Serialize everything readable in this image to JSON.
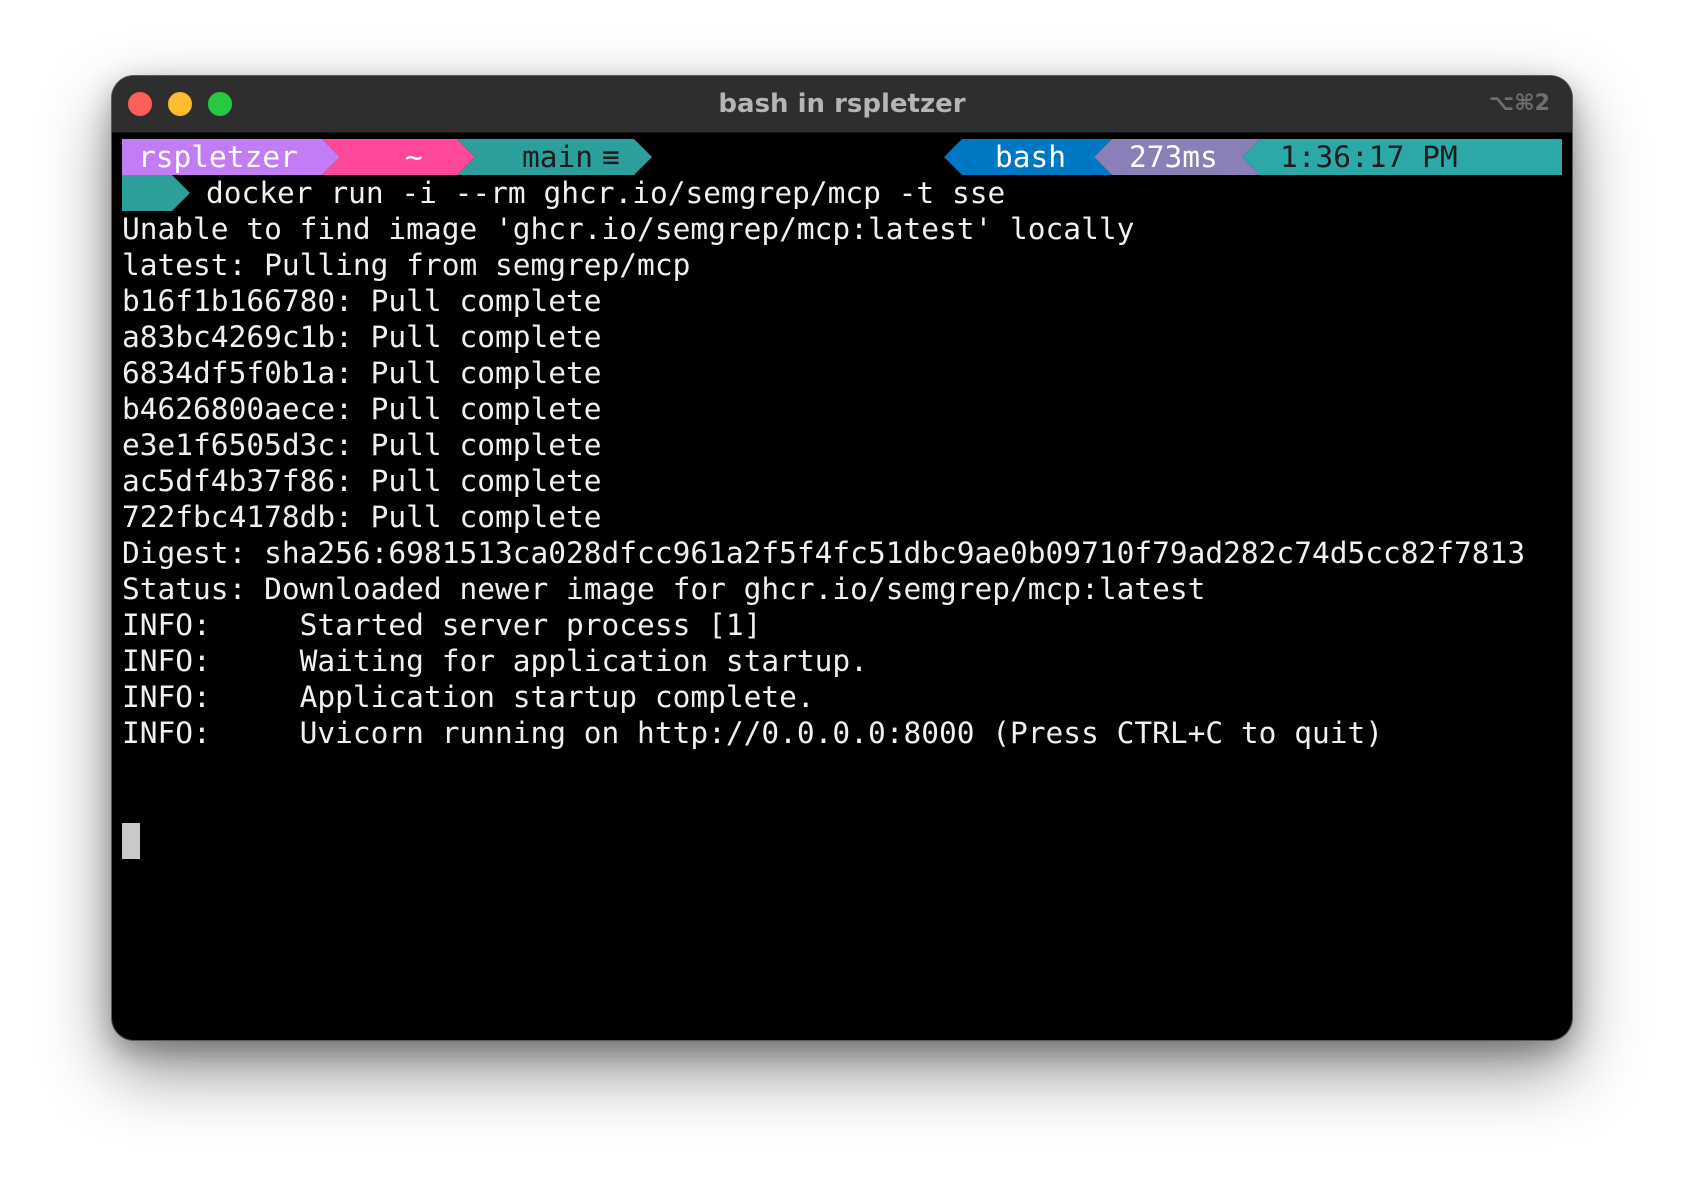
{
  "window": {
    "title": "bash in rspletzer",
    "shortcut": "⌥⌘2"
  },
  "prompt": {
    "user": "rspletzer",
    "path": "~",
    "branch": "main",
    "branch_status": "≡",
    "shell": "bash",
    "duration": "273ms",
    "time": "1:36:17 PM",
    "command": "docker run -i --rm ghcr.io/semgrep/mcp -t sse"
  },
  "colors": {
    "user_bg": "#c27cf4",
    "path_bg": "#ff479c",
    "git_bg": "#2c9e9c",
    "shell_bg": "#0077c2",
    "duration_bg": "#8a80b7",
    "time_bg": "#2ca8a8",
    "status_bg": "#2c9e9c"
  },
  "output": [
    "Unable to find image 'ghcr.io/semgrep/mcp:latest' locally",
    "latest: Pulling from semgrep/mcp",
    "b16f1b166780: Pull complete",
    "a83bc4269c1b: Pull complete",
    "6834df5f0b1a: Pull complete",
    "b4626800aece: Pull complete",
    "e3e1f6505d3c: Pull complete",
    "ac5df4b37f86: Pull complete",
    "722fbc4178db: Pull complete",
    "Digest: sha256:6981513ca028dfcc961a2f5f4fc51dbc9ae0b09710f79ad282c74d5cc82f7813",
    "Status: Downloaded newer image for ghcr.io/semgrep/mcp:latest",
    "INFO:     Started server process [1]",
    "INFO:     Waiting for application startup.",
    "INFO:     Application startup complete.",
    "INFO:     Uvicorn running on http://0.0.0.0:8000 (Press CTRL+C to quit)"
  ]
}
